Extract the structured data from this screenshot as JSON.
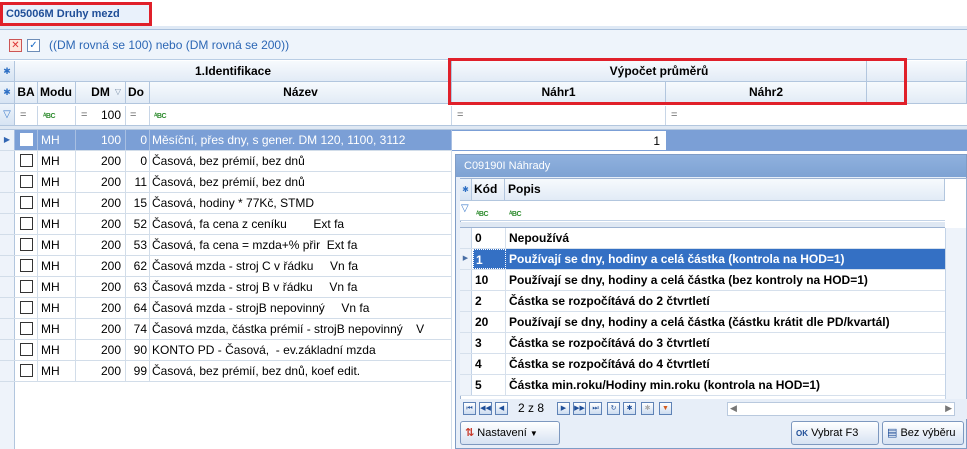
{
  "window": {
    "title": "C05006M Druhy mezd"
  },
  "filter": {
    "expression": "((DM rovná se 100) nebo (DM rovná se 200))"
  },
  "grid": {
    "group_headers": {
      "identification": "1.Identifikace",
      "average_calc": "Výpočet průměrů"
    },
    "columns": {
      "ba": "BA",
      "modul": "Modu",
      "dm": "DM",
      "dop": "Do",
      "nazev": "Název",
      "nahr1": "Náhr1",
      "nahr2": "Náhr2"
    },
    "filter_row": {
      "dm": "100"
    },
    "rows": [
      {
        "modul": "MH",
        "dm": "100",
        "dop": "0",
        "nazev": "Měsíční, přes dny, s gener. DM 120, 1100, 3112",
        "nahr1": "1"
      },
      {
        "modul": "MH",
        "dm": "200",
        "dop": "0",
        "nazev": "Časová, bez prémií, bez dnů"
      },
      {
        "modul": "MH",
        "dm": "200",
        "dop": "11",
        "nazev": "Časová, bez prémií, bez dnů"
      },
      {
        "modul": "MH",
        "dm": "200",
        "dop": "15",
        "nazev": "Časová, hodiny * 77Kč, STMD"
      },
      {
        "modul": "MH",
        "dm": "200",
        "dop": "52",
        "nazev": "Časová, fa cena z ceníku        Ext fa"
      },
      {
        "modul": "MH",
        "dm": "200",
        "dop": "53",
        "nazev": "Časová, fa cena = mzda+% přir  Ext fa"
      },
      {
        "modul": "MH",
        "dm": "200",
        "dop": "62",
        "nazev": "Časová mzda - stroj C v řádku     Vn fa"
      },
      {
        "modul": "MH",
        "dm": "200",
        "dop": "63",
        "nazev": "Časová mzda - stroj B v řádku     Vn fa"
      },
      {
        "modul": "MH",
        "dm": "200",
        "dop": "64",
        "nazev": "Časová mzda - strojB nepovinný     Vn fa"
      },
      {
        "modul": "MH",
        "dm": "200",
        "dop": "74",
        "nazev": "Časová mzda, částka prémií - strojB nepovinný    V"
      },
      {
        "modul": "MH",
        "dm": "200",
        "dop": "90",
        "nazev": "KONTO PD - Časová,  - ev.základní mzda"
      },
      {
        "modul": "MH",
        "dm": "200",
        "dop": "99",
        "nazev": "Časová, bez prémií, bez dnů, koef edit."
      }
    ]
  },
  "popup": {
    "title": "C09190I Náhrady",
    "columns": {
      "kod": "Kód",
      "popis": "Popis"
    },
    "rows": [
      {
        "kod": "0",
        "popis": "Nepoužívá"
      },
      {
        "kod": "1",
        "popis": "Používají se dny, hodiny a celá částka (kontrola na HOD=1)"
      },
      {
        "kod": "10",
        "popis": "Používají se dny, hodiny a celá částka (bez kontroly na HOD=1)"
      },
      {
        "kod": "2",
        "popis": "Částka se rozpočítává do 2 čtvrtletí"
      },
      {
        "kod": "20",
        "popis": "Používají se dny, hodiny a celá částka (částku krátit dle PD/kvartál)"
      },
      {
        "kod": "3",
        "popis": "Částka se rozpočítává do 3 čtvrtletí"
      },
      {
        "kod": "4",
        "popis": "Částka se rozpočítává do 4 čtvrtletí"
      },
      {
        "kod": "5",
        "popis": "Částka min.roku/Hodiny min.roku (kontrola na HOD=1)"
      }
    ],
    "pager": "2 z 8",
    "buttons": {
      "settings": "Nastavení",
      "select": "Vybrat F3",
      "no_select": "Bez výběru"
    }
  },
  "colors": {
    "accent": "#3470c4",
    "selected_row": "#7b9fd6",
    "annotation": "#e0202a"
  }
}
